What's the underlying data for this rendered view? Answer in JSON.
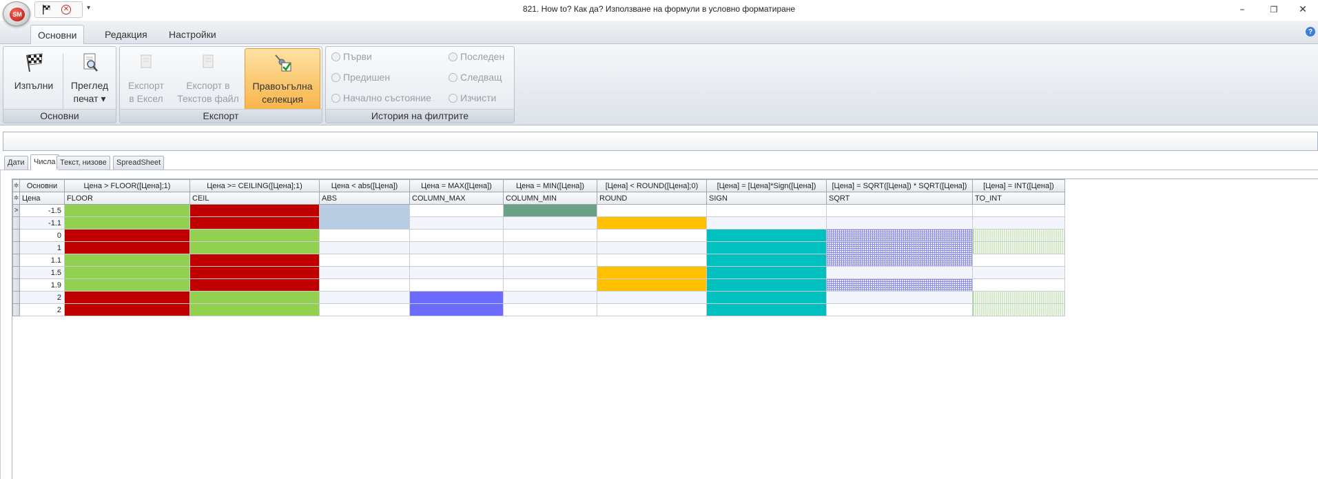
{
  "window": {
    "title": "821. How to? Как да? Използване на формули в условно форматиране",
    "logo_text": "SM"
  },
  "ribbon": {
    "tabs": [
      "Основни",
      "Редакция",
      "Настройки"
    ],
    "groups": {
      "main": {
        "label": "Основни",
        "run": "Изпълни",
        "preview_line1": "Преглед",
        "preview_line2": "печат ▾"
      },
      "export": {
        "label": "Експорт",
        "excel_line1": "Експорт",
        "excel_line2": "в Ексел",
        "text_line1": "Експорт в",
        "text_line2": "Текстов файл",
        "rect_line1": "Правоъгълна",
        "rect_line2": "селекция"
      },
      "history": {
        "label": "История на филтрите",
        "first": "Първи",
        "last": "Последен",
        "previous": "Предишен",
        "next": "Следващ",
        "initial": "Начално състояние",
        "clear": "Изчисти"
      }
    }
  },
  "sheet_tabs": [
    "Дати",
    "Числа",
    "Текст, низове",
    "SpreadSheet"
  ],
  "grid": {
    "headers": [
      "Основни",
      "Цена > FLOOR([Цена];1)",
      "Цена >= CEILING([Цена];1)",
      "Цена < abs([Цена])",
      "Цена = MAX([Цена])",
      "Цена = MIN([Цена])",
      "[Цена] < ROUND([Цена];0)",
      "[Цена] = [Цена]*Sign([Цена])",
      "[Цена] = SQRT([Цена]) * SQRT([Цена])",
      "[Цена] = INT([Цена])"
    ],
    "subheaders": [
      "Цена",
      "FLOOR",
      "CEIL",
      "ABS",
      "COLUMN_MAX",
      "COLUMN_MIN",
      "ROUND",
      "SIGN",
      "SQRT",
      "TO_INT"
    ],
    "rows": [
      {
        "indicator": ">",
        "price": "-1.5",
        "fills": [
          "green",
          "red",
          "lightblue",
          "",
          "darkgreen",
          "",
          "",
          "",
          ""
        ]
      },
      {
        "indicator": "",
        "price": "-1.1",
        "fills": [
          "green",
          "red",
          "lightblue",
          "",
          "",
          "orange",
          "",
          "",
          ""
        ]
      },
      {
        "indicator": "",
        "price": "0",
        "fills": [
          "red",
          "green",
          "",
          "",
          "",
          "",
          "teal",
          "hatch",
          "stripe"
        ]
      },
      {
        "indicator": "",
        "price": "1",
        "fills": [
          "red",
          "green",
          "",
          "",
          "",
          "",
          "teal",
          "hatch",
          "stripe"
        ]
      },
      {
        "indicator": "",
        "price": "1.1",
        "fills": [
          "green",
          "red",
          "",
          "",
          "",
          "",
          "teal",
          "hatch",
          ""
        ]
      },
      {
        "indicator": "",
        "price": "1.5",
        "fills": [
          "green",
          "red",
          "",
          "",
          "",
          "orange",
          "teal",
          "",
          ""
        ]
      },
      {
        "indicator": "",
        "price": "1.9",
        "fills": [
          "green",
          "red",
          "",
          "",
          "",
          "orange",
          "teal",
          "hatch",
          ""
        ]
      },
      {
        "indicator": "",
        "price": "2",
        "fills": [
          "red",
          "green",
          "",
          "blue",
          "",
          "",
          "teal",
          "",
          "stripe"
        ]
      },
      {
        "indicator": "",
        "price": "2",
        "fills": [
          "red",
          "green",
          "",
          "blue",
          "",
          "",
          "teal",
          "",
          "stripe"
        ]
      }
    ]
  },
  "colors": {
    "green": "#92d050",
    "red": "#c00000",
    "lightblue": "#b8cce4",
    "darkgreen": "#6aa187",
    "orange": "#ffc000",
    "blue": "#6b6bff",
    "teal": "#00c0c0",
    "hatch": "#8a8cf0",
    "stripe": "#a7d48c"
  }
}
